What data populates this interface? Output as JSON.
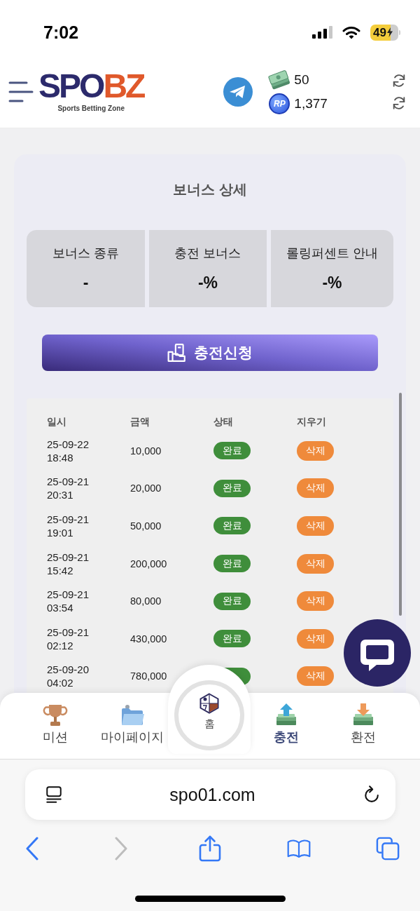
{
  "status_bar": {
    "time": "7:02",
    "battery": "49"
  },
  "header": {
    "logo": {
      "wordmark": [
        "SPO",
        "BZ"
      ],
      "tagline": "Sports Betting Zone"
    },
    "balances": [
      {
        "kind": "cash",
        "value": "50"
      },
      {
        "kind": "points",
        "coin_label": "RP",
        "value": "1,377"
      }
    ]
  },
  "bonus_card": {
    "title": "보너스 상세",
    "details": [
      {
        "label": "보너스 종류",
        "value": "-"
      },
      {
        "label": "충전 보너스",
        "value": "-%"
      },
      {
        "label": "롤링퍼센트 안내",
        "value": "-%"
      }
    ],
    "apply_button": "충전신청"
  },
  "history": {
    "columns": [
      "일시",
      "금액",
      "상태",
      "지우기"
    ],
    "rows": [
      {
        "date": "25-09-22",
        "time": "18:48",
        "amount": "10,000",
        "status": "완료",
        "action": "삭제"
      },
      {
        "date": "25-09-21",
        "time": "20:31",
        "amount": "20,000",
        "status": "완료",
        "action": "삭제"
      },
      {
        "date": "25-09-21",
        "time": "19:01",
        "amount": "50,000",
        "status": "완료",
        "action": "삭제"
      },
      {
        "date": "25-09-21",
        "time": "15:42",
        "amount": "200,000",
        "status": "완료",
        "action": "삭제"
      },
      {
        "date": "25-09-21",
        "time": "03:54",
        "amount": "80,000",
        "status": "완료",
        "action": "삭제"
      },
      {
        "date": "25-09-21",
        "time": "02:12",
        "amount": "430,000",
        "status": "완료",
        "action": "삭제"
      },
      {
        "date": "25-09-20",
        "time": "04:02",
        "amount": "780,000",
        "action": "삭제"
      }
    ]
  },
  "bottom_nav": {
    "items": [
      {
        "label": "미션",
        "kind": "trophy",
        "selected": false
      },
      {
        "label": "마이페이지",
        "kind": "folder",
        "selected": false
      },
      {
        "label": "충전",
        "kind": "deposit",
        "selected": true
      },
      {
        "label": "환전",
        "kind": "withdraw",
        "selected": false
      }
    ],
    "home": {
      "label": "홈"
    }
  },
  "browser": {
    "url": "spo01.com",
    "toolbar": [
      {
        "kind": "back",
        "disabled": false
      },
      {
        "kind": "forward",
        "disabled": true
      },
      {
        "kind": "share",
        "disabled": false
      },
      {
        "kind": "bookmarks",
        "disabled": false
      },
      {
        "kind": "tabs",
        "disabled": false
      }
    ]
  }
}
